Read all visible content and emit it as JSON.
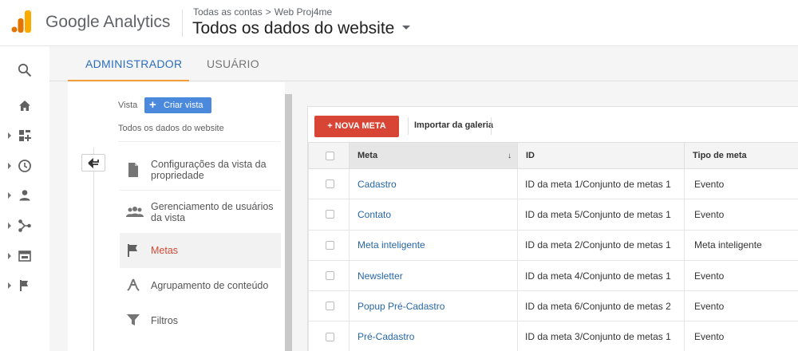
{
  "app": {
    "brand": "Google Analytics",
    "breadcrumb_root": "Todas as contas",
    "breadcrumb_sep": ">",
    "breadcrumb_property": "Web Proj4me",
    "view_title": "Todos os dados do website"
  },
  "colors": {
    "logo_orange": "#f9ab00",
    "logo_dark_orange": "#e37400",
    "primary_red": "#d94535",
    "link_blue": "#2667a6",
    "tab_orange": "#f29d38"
  },
  "rail": {
    "items": [
      {
        "icon": "search-icon"
      },
      {
        "icon": "home-icon"
      },
      {
        "icon": "customization-icon"
      },
      {
        "icon": "clock-icon"
      },
      {
        "icon": "person-icon"
      },
      {
        "icon": "acquisition-icon"
      },
      {
        "icon": "behavior-icon"
      },
      {
        "icon": "flag-icon"
      }
    ]
  },
  "tabs": {
    "admin": "ADMINISTRADOR",
    "user": "USUÁRIO"
  },
  "panel": {
    "vista_label": "Vista",
    "create_view_label": "Criar vista",
    "view_name": "Todos os dados do website",
    "items": [
      {
        "label": "Configurações da vista da propriedade",
        "icon": "document-icon"
      },
      {
        "label": "Gerenciamento de usuários da vista",
        "icon": "people-icon"
      },
      {
        "label": "Metas",
        "icon": "flag-icon"
      },
      {
        "label": "Agrupamento de conteúdo",
        "icon": "walk-icon"
      },
      {
        "label": "Filtros",
        "icon": "filter-icon"
      }
    ]
  },
  "toolbar": {
    "new_goal": "+ NOVA META",
    "import_gallery": "Importar da galeria"
  },
  "table": {
    "headers": {
      "goal": "Meta",
      "id": "ID",
      "type": "Tipo de meta"
    },
    "rows": [
      {
        "name": "Cadastro",
        "id": "ID da meta 1/Conjunto de metas 1",
        "type": "Evento"
      },
      {
        "name": "Contato",
        "id": "ID da meta 5/Conjunto de metas 1",
        "type": "Evento"
      },
      {
        "name": "Meta inteligente",
        "id": "ID da meta 2/Conjunto de metas 1",
        "type": "Meta inteligente"
      },
      {
        "name": "Newsletter",
        "id": "ID da meta 4/Conjunto de metas 1",
        "type": "Evento"
      },
      {
        "name": "Popup Pré-Cadastro",
        "id": "ID da meta 6/Conjunto de metas 2",
        "type": "Evento"
      },
      {
        "name": "Pré-Cadastro",
        "id": "ID da meta 3/Conjunto de metas 1",
        "type": "Evento"
      }
    ]
  }
}
